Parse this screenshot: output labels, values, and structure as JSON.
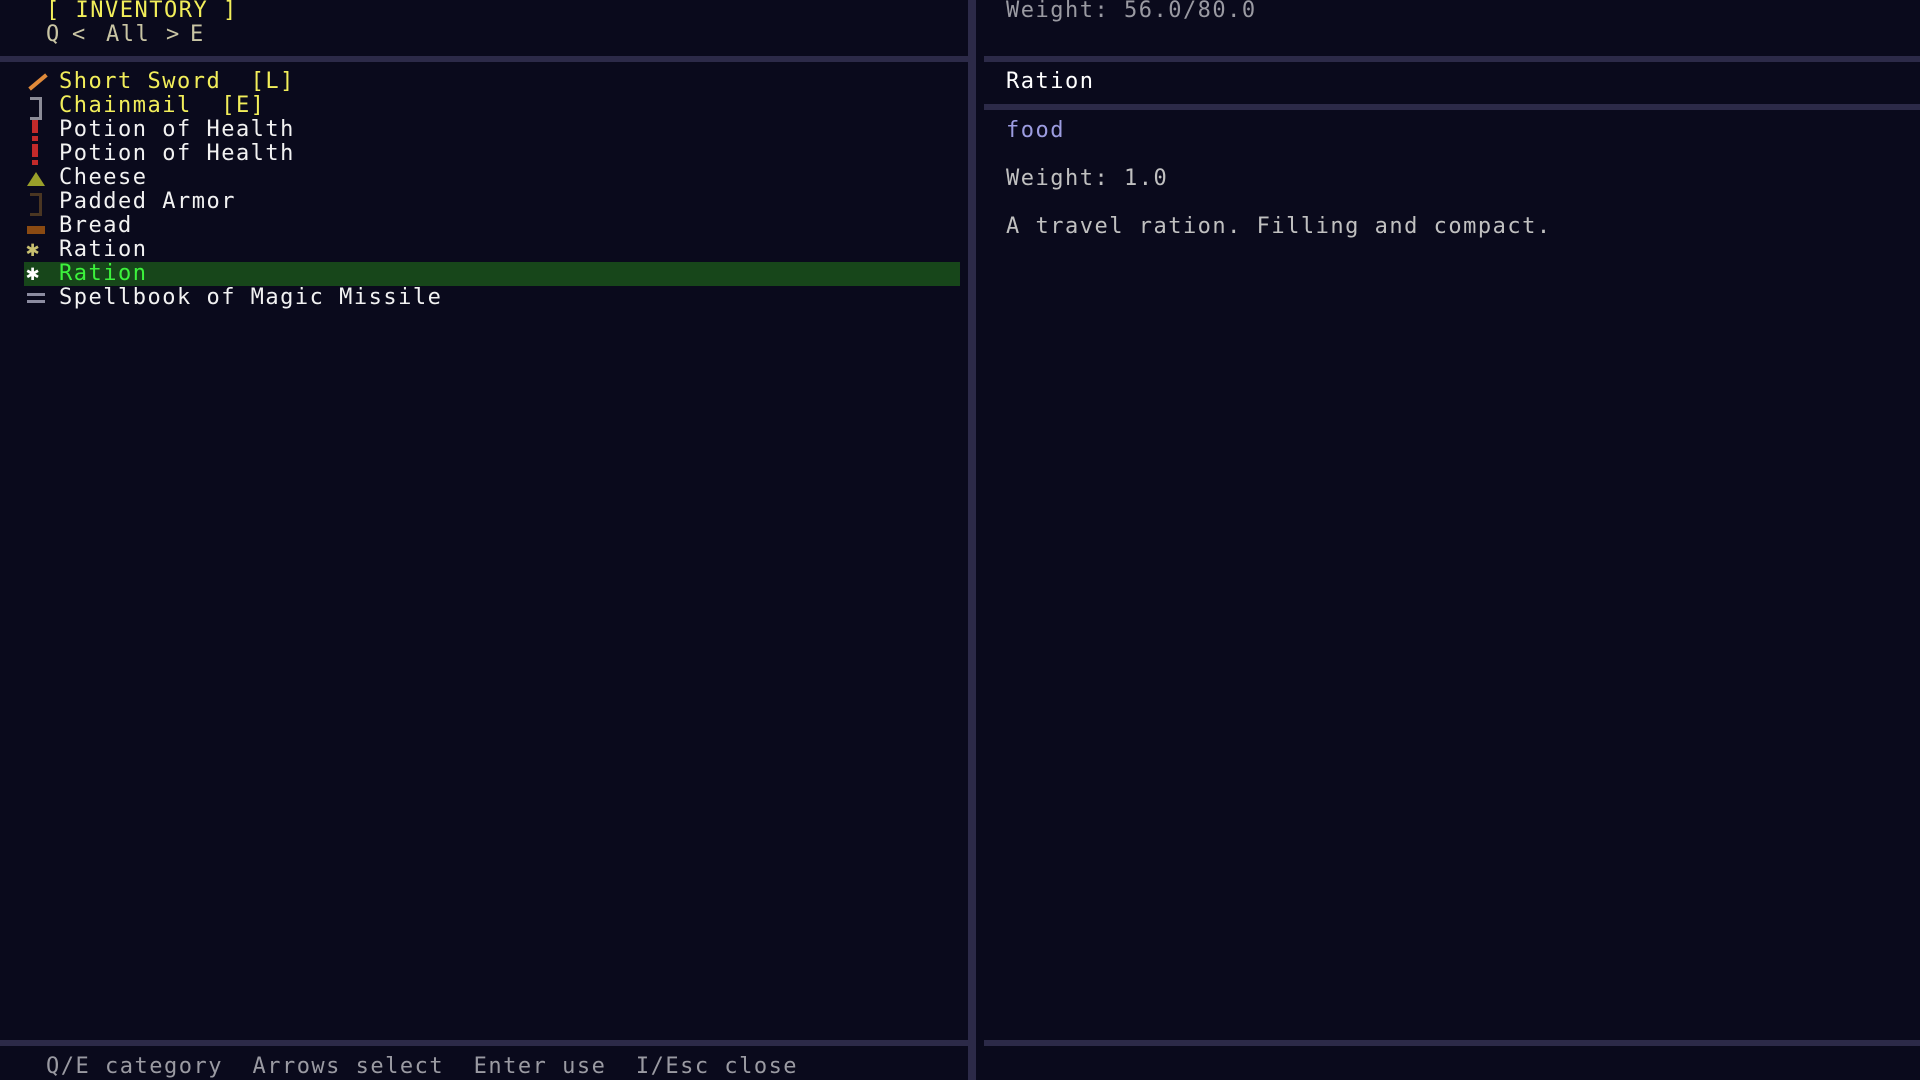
{
  "header": {
    "title": "[ INVENTORY ]",
    "category_prev_key": "Q",
    "category_prev_arrow": "<",
    "category_name": "All",
    "category_next_arrow": ">",
    "category_next_key": "E",
    "weight_summary": "Weight: 56.0/80.0"
  },
  "inventory": {
    "selected_index": 8,
    "items": [
      {
        "label": "Short Sword  [L]",
        "icon": "sword-icon",
        "state": "equipped"
      },
      {
        "label": "Chainmail  [E]",
        "icon": "armor-icon",
        "state": "equipped"
      },
      {
        "label": "Potion of Health",
        "icon": "potion-icon",
        "state": "normal"
      },
      {
        "label": "Potion of Health",
        "icon": "potion-icon",
        "state": "normal"
      },
      {
        "label": "Cheese",
        "icon": "cheese-icon",
        "state": "normal"
      },
      {
        "label": "Padded Armor",
        "icon": "armor-icon",
        "state": "normal"
      },
      {
        "label": "Bread",
        "icon": "bread-icon",
        "state": "normal"
      },
      {
        "label": "Ration",
        "icon": "ration-icon",
        "state": "normal"
      },
      {
        "label": "Ration",
        "icon": "ration-icon",
        "state": "selected"
      },
      {
        "label": "Spellbook of Magic Missile",
        "icon": "spellbook-icon",
        "state": "normal"
      }
    ]
  },
  "detail": {
    "name": "Ration",
    "type": "food",
    "weight": "Weight: 1.0",
    "description": "A travel ration. Filling and compact."
  },
  "footer": {
    "hint_category": "Q/E category",
    "hint_select": "Arrows select",
    "hint_use": "Enter use",
    "hint_close": "I/Esc close"
  },
  "colors": {
    "background": "#0a0a1c",
    "separator": "#2c2a48",
    "equipped_text": "#f2ee5a",
    "selected_row": "#17461a",
    "selected_text": "#3cf23c",
    "type_text": "#9c9ce0"
  }
}
